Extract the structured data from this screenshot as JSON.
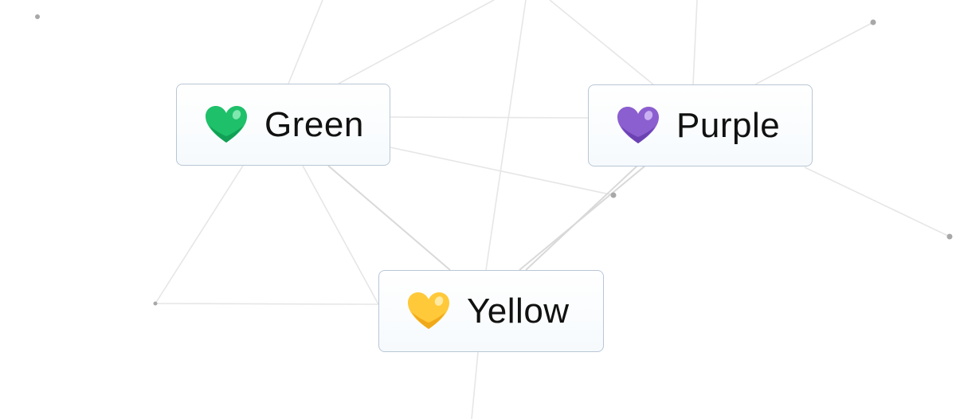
{
  "canvas": {
    "elements": [
      {
        "id": "green",
        "label": "Green",
        "icon": "green-heart-icon",
        "color": "#1fc06a"
      },
      {
        "id": "purple",
        "label": "Purple",
        "icon": "purple-heart-icon",
        "color": "#8b5fcf"
      },
      {
        "id": "yellow",
        "label": "Yellow",
        "icon": "yellow-heart-icon",
        "color": "#ffc93a"
      }
    ]
  }
}
